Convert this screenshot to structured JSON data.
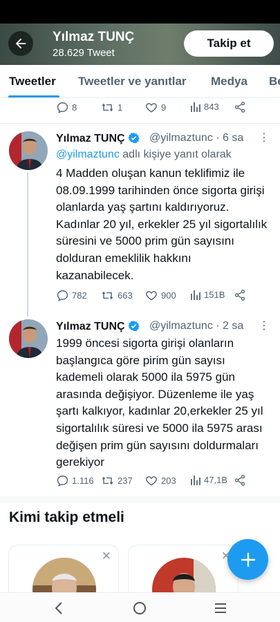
{
  "header": {
    "name": "Yılmaz TUNÇ",
    "tweet_count": "28.629 Tweet",
    "follow_label": "Takip et"
  },
  "tabs": [
    {
      "label": "Tweetler",
      "active": true
    },
    {
      "label": "Tweetler ve yanıtlar",
      "active": false
    },
    {
      "label": "Medya",
      "active": false
    },
    {
      "label": "Be",
      "active": false
    }
  ],
  "top_actions": {
    "replies": "8",
    "retweets": "1",
    "likes": "9",
    "views": "843"
  },
  "tweets": [
    {
      "name": "Yılmaz TUNÇ",
      "handle": "@yilmaztunc",
      "time": "· 6 sa",
      "reply_mention": "@yilmaztunc",
      "reply_suffix": " adlı kişiye yanıt olarak",
      "text": "4 Madden oluşan kanun teklifimiz ile 08.09.1999 tarihinden önce sigorta girişi olanlarda yaş şartını kaldırıyoruz. Kadınlar 20 yıl, erkekler 25 yıl sigortalılık süresini ve 5000 prim gün sayısını dolduran emeklilik hakkını kazanabilecek.",
      "replies": "782",
      "retweets": "663",
      "likes": "900",
      "views": "151B"
    },
    {
      "name": "Yılmaz TUNÇ",
      "handle": "@yilmaztunc",
      "time": "· 2 sa",
      "text": "1999 öncesi sigorta girişi olanların başlangıca göre pirim gün sayısı kademeli olarak 5000 ila 5975 gün arasında değişiyor. Düzenleme ile yaş şartı kalkıyor, kadınlar 20,erkekler 25 yıl sigortalılık süresi ve 5000 ila 5975 arası değişen prim gün sayısını doldurmaları gerekiyor",
      "replies": "1.116",
      "retweets": "237",
      "likes": "203",
      "views": "47,1B"
    }
  ],
  "suggestions": {
    "title": "Kimi takip etmeli"
  },
  "icons": {
    "back": "arrow-left-icon",
    "verified": "verified-badge-icon",
    "compose": "plus-icon",
    "nav_back": "chevron-left-icon",
    "nav_home": "circle-icon",
    "nav_menu": "hamburger-icon"
  },
  "colors": {
    "accent": "#1d9bf0",
    "text": "#0f1419",
    "secondary": "#536471"
  }
}
